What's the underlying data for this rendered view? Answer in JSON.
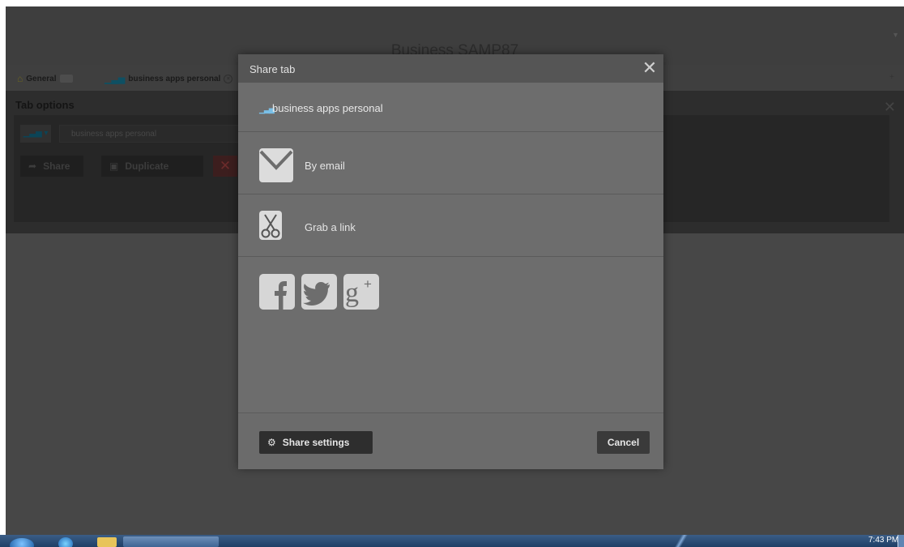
{
  "app": {
    "title": "Business SAMP87"
  },
  "tabs": [
    {
      "label": "General",
      "icon": "home-icon"
    },
    {
      "label": "business apps personal",
      "icon": "bar-chart-icon"
    }
  ],
  "tab_options": {
    "title": "Tab options",
    "name_value": "business apps personal",
    "share_label": "Share",
    "duplicate_label": "Duplicate"
  },
  "dialog": {
    "title": "Share tab",
    "tab_name": "business apps personal",
    "options": [
      {
        "label": "By email",
        "icon": "envelope-icon"
      },
      {
        "label": "Grab a link",
        "icon": "scissors-icon"
      }
    ],
    "social": [
      "facebook-icon",
      "twitter-icon",
      "google-plus-icon"
    ],
    "share_settings_label": "Share settings",
    "cancel_label": "Cancel"
  },
  "taskbar": {
    "clock": "7:43 PM"
  },
  "colors": {
    "dialog_bg": "#6d6d6d",
    "dialog_header": "#555555",
    "overlay": "#474747",
    "accent_blue": "#79bfe7"
  }
}
